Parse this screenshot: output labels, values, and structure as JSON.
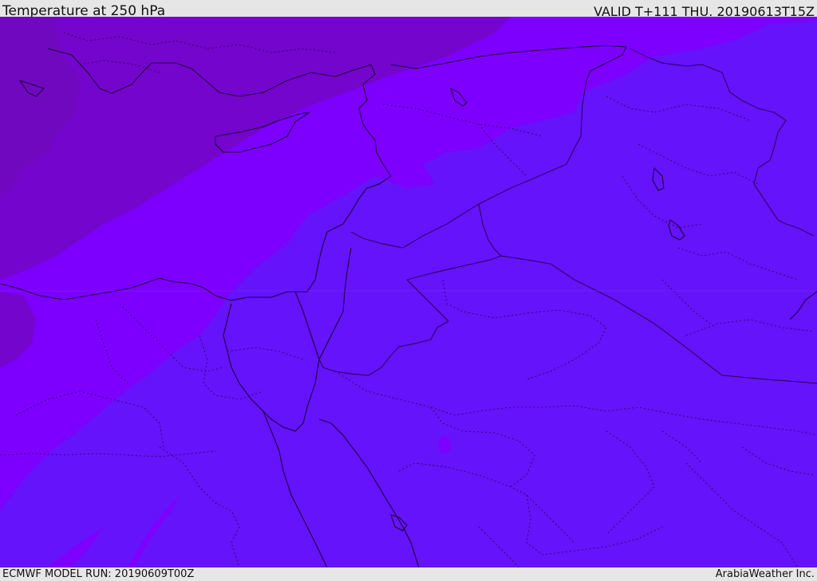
{
  "header": {
    "title": "Temperature at 250 hPa",
    "valid": "VALID T+111 THU. 20190613T15Z"
  },
  "footer": {
    "model_run": "ECMWF MODEL RUN: 20190609T00Z",
    "credit": "ArabiaWeather Inc."
  },
  "map": {
    "colors": {
      "band_dark": "#7405cc",
      "band_mid": "#7d00ff",
      "band_light": "#6413fa",
      "coastline": "#1a0033",
      "borders": "#240046"
    }
  }
}
